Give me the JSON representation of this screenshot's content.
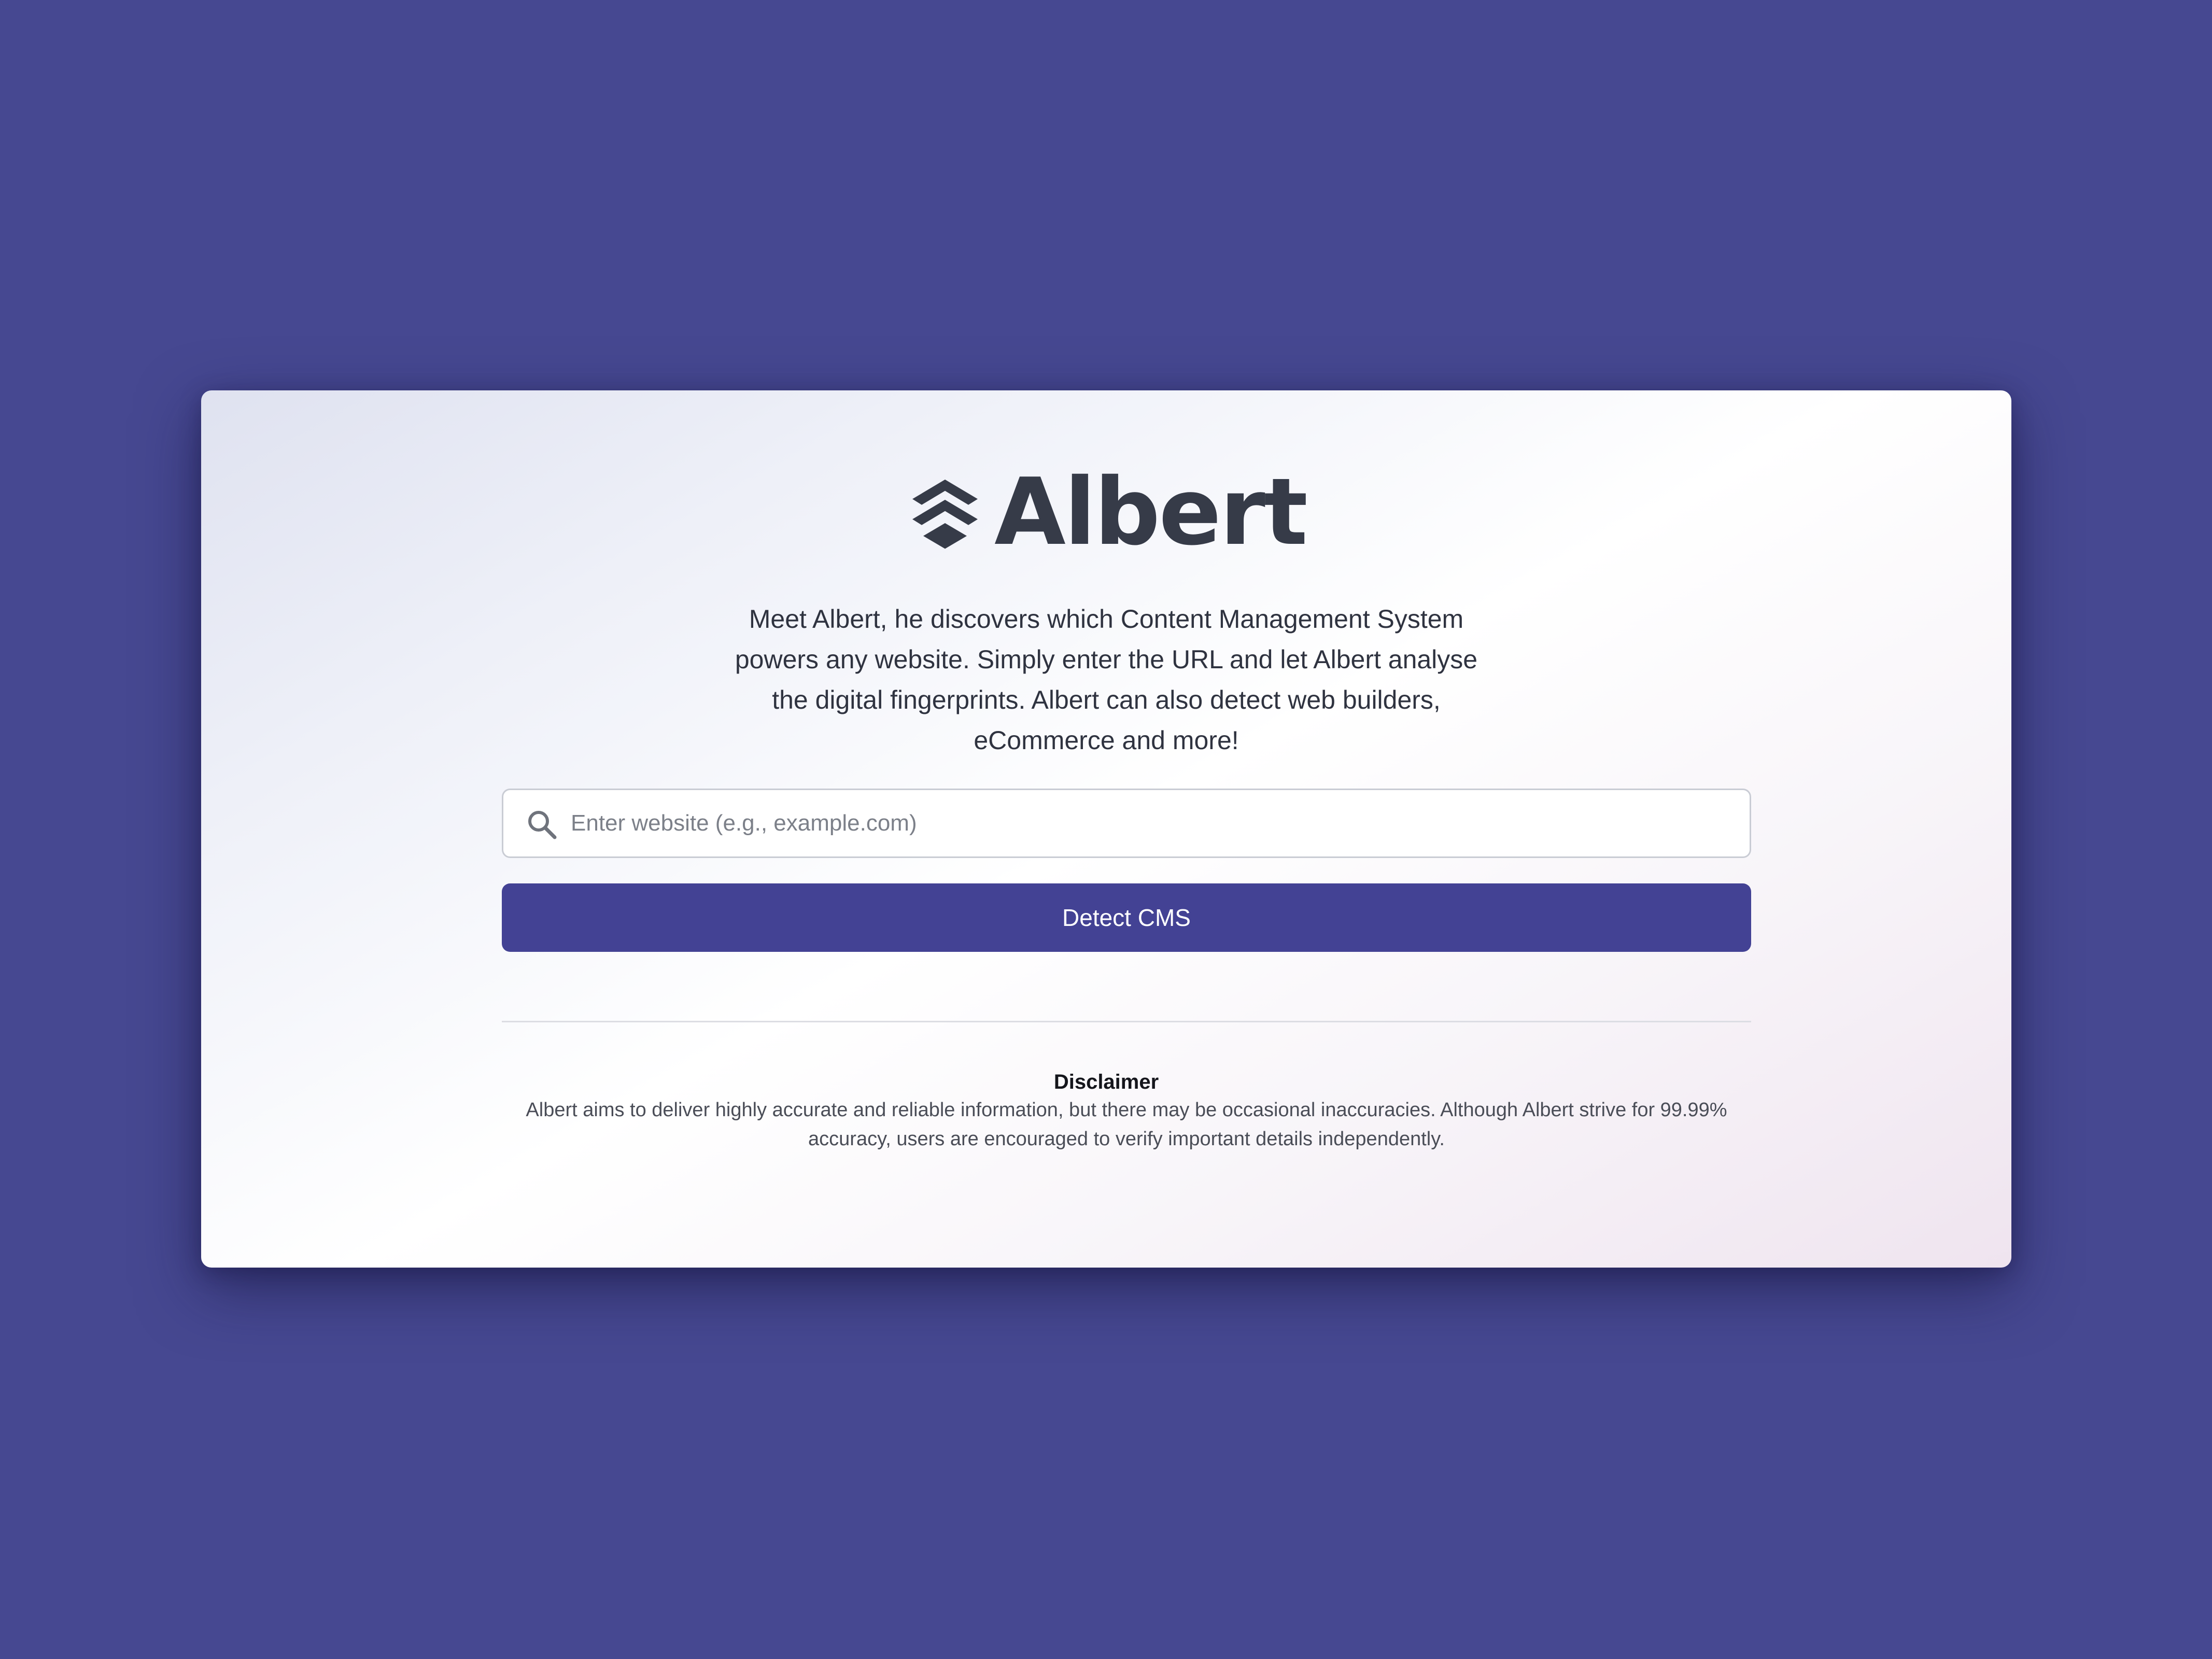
{
  "brand": {
    "name": "Albert",
    "logo_icon": "stacked-layers-icon",
    "color": "#363b48"
  },
  "intro": {
    "text": "Meet Albert, he discovers which Content Management System powers any website. Simply enter the URL and let Albert analyse the digital fingerprints. Albert can also detect web builders, eCommerce and more!"
  },
  "search": {
    "icon": "search-icon",
    "placeholder": "Enter website (e.g., example.com)",
    "value": ""
  },
  "detect_button": {
    "label": "Detect CMS",
    "color": "#434294"
  },
  "disclaimer": {
    "title": "Disclaimer",
    "text": "Albert aims to deliver highly accurate and reliable information, but there may be occasional inaccuracies. Although Albert strive for 99.99% accuracy, users are encouraged to verify important details independently."
  },
  "colors": {
    "page_background": "#464891",
    "accent": "#434294"
  }
}
